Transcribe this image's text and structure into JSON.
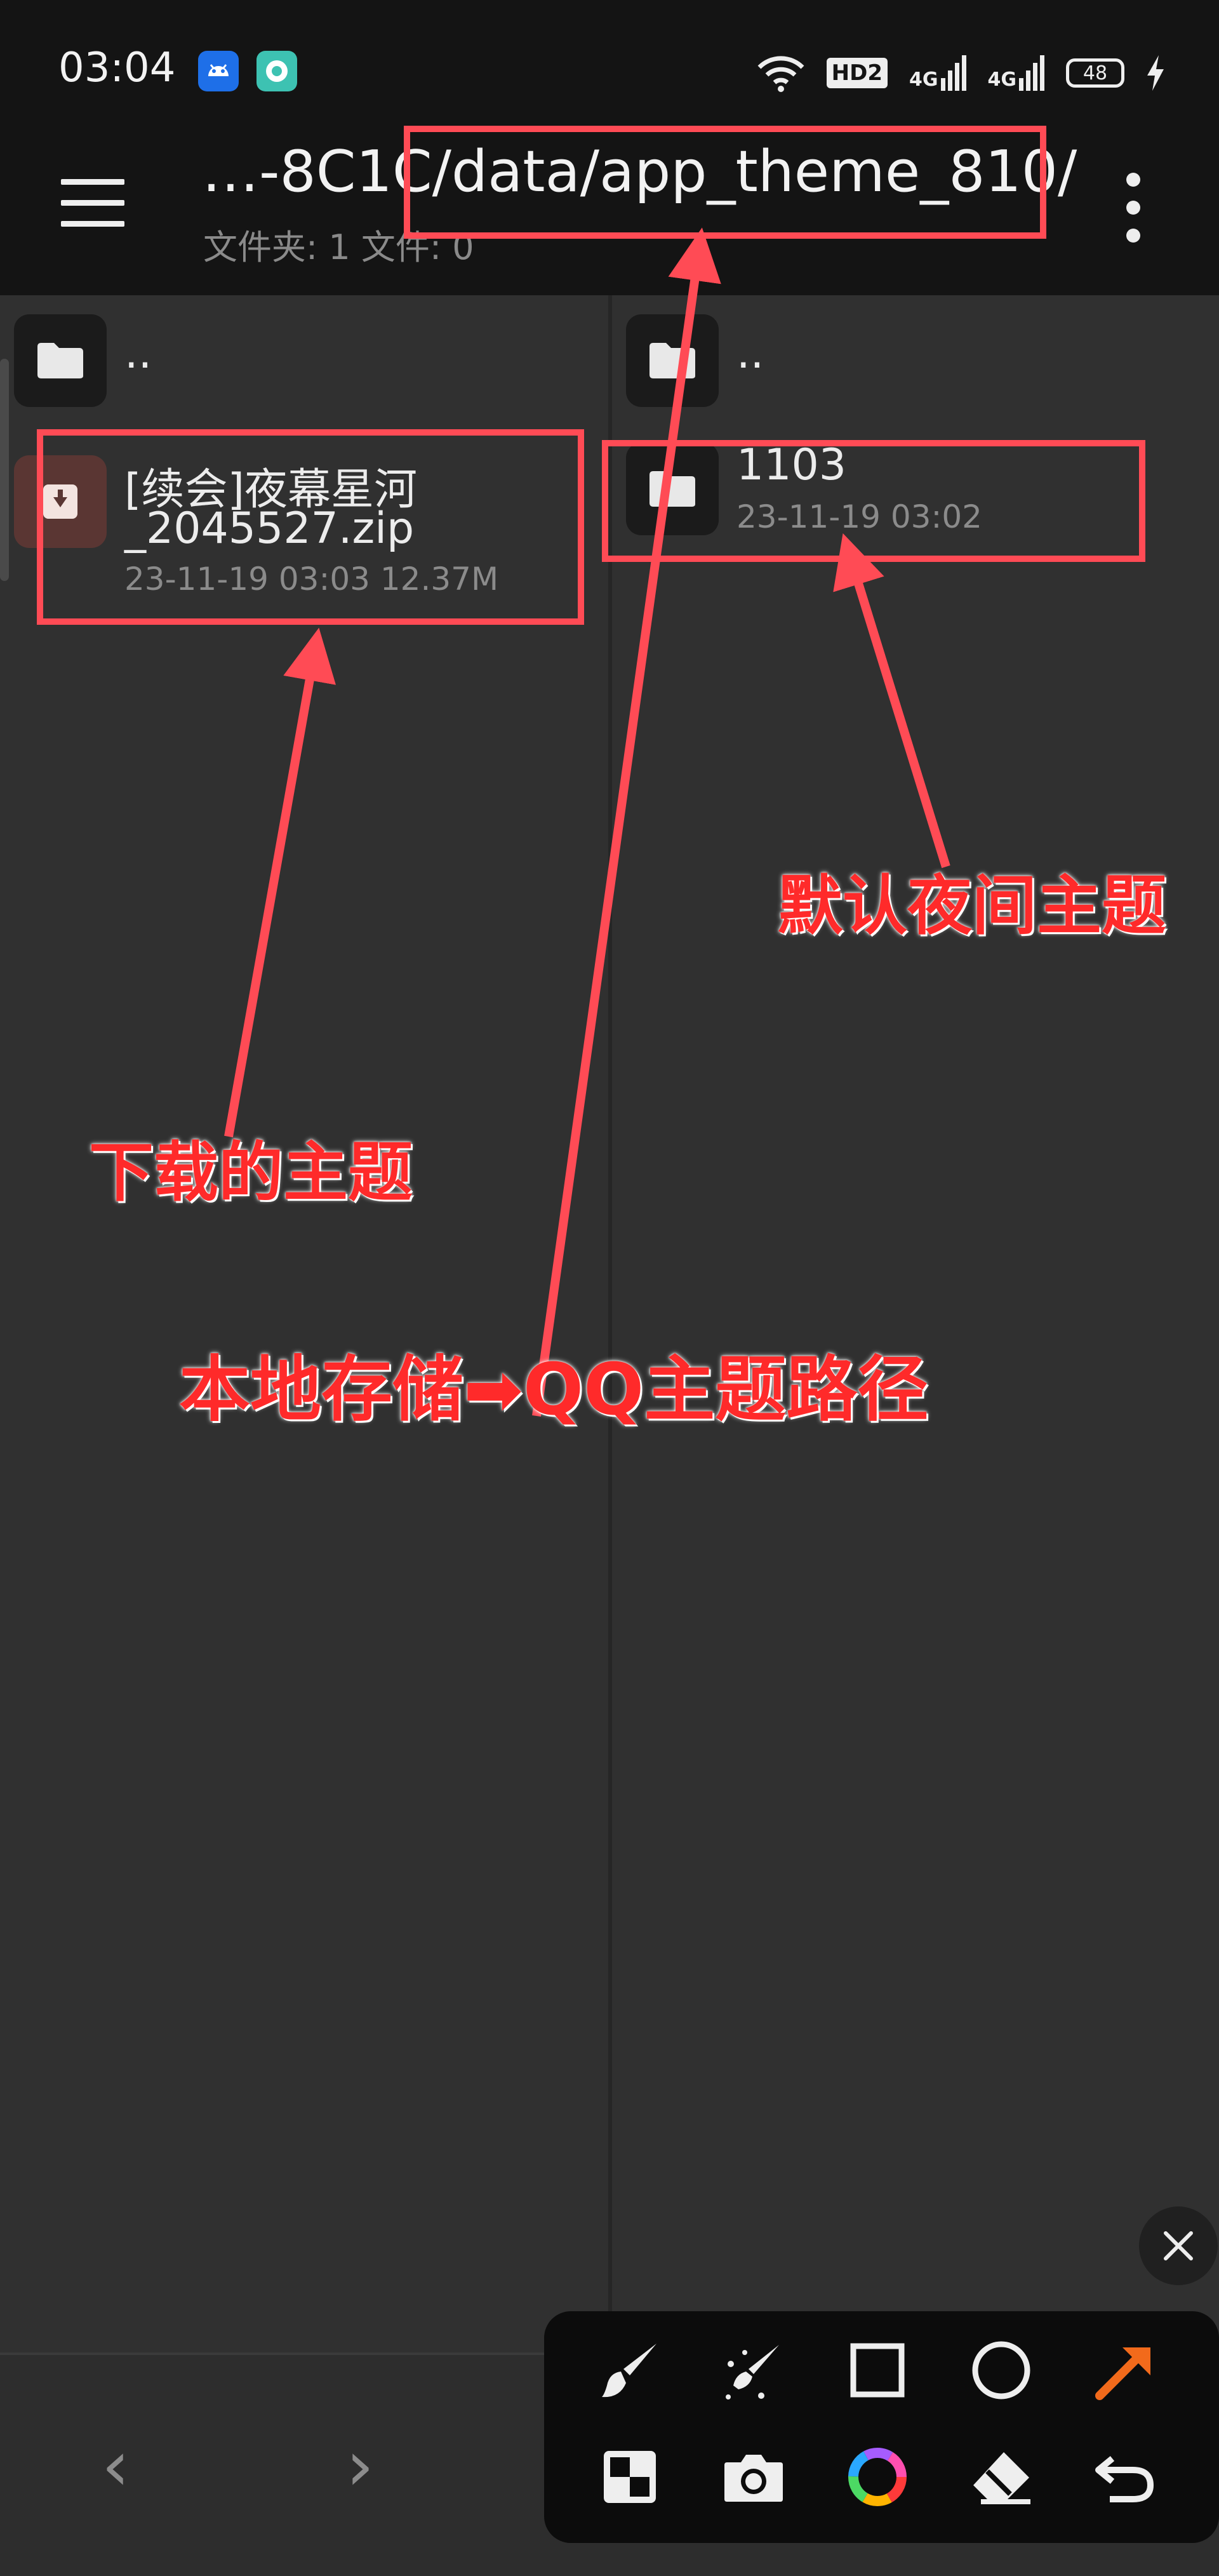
{
  "status_bar": {
    "time": "03:04",
    "icons": [
      "android-icon",
      "chat-app-icon",
      "wifi-icon",
      "hd-icon",
      "signal-4g-icon",
      "signal-4g-icon",
      "battery-icon",
      "charging-icon"
    ],
    "hd_label": "HD2",
    "net1_label": "4G",
    "net2_label": "4G",
    "battery": "48"
  },
  "top_bar": {
    "path": "…-8C1C/data/app_theme_810/",
    "subtitle": "文件夹: 1  文件: 0"
  },
  "left_pane": {
    "parent_label": "..",
    "file": {
      "name_line1": "[续会]夜幕星河",
      "name_line2": "_2045527.zip",
      "meta": "23-11-19 03:03  12.37M"
    }
  },
  "right_pane": {
    "parent_label": "..",
    "folder": {
      "name": "1103",
      "meta": "23-11-19 03:02"
    }
  },
  "annotations": {
    "downloaded": "下载的主题",
    "default_night": "默认夜间主题",
    "path_note": "本地存储➡QQ主题路径"
  },
  "colors": {
    "annotation_red": "#ff4b55",
    "background": "#303030",
    "top_bar": "#141414",
    "accent_arrow": "#f26a1b"
  }
}
